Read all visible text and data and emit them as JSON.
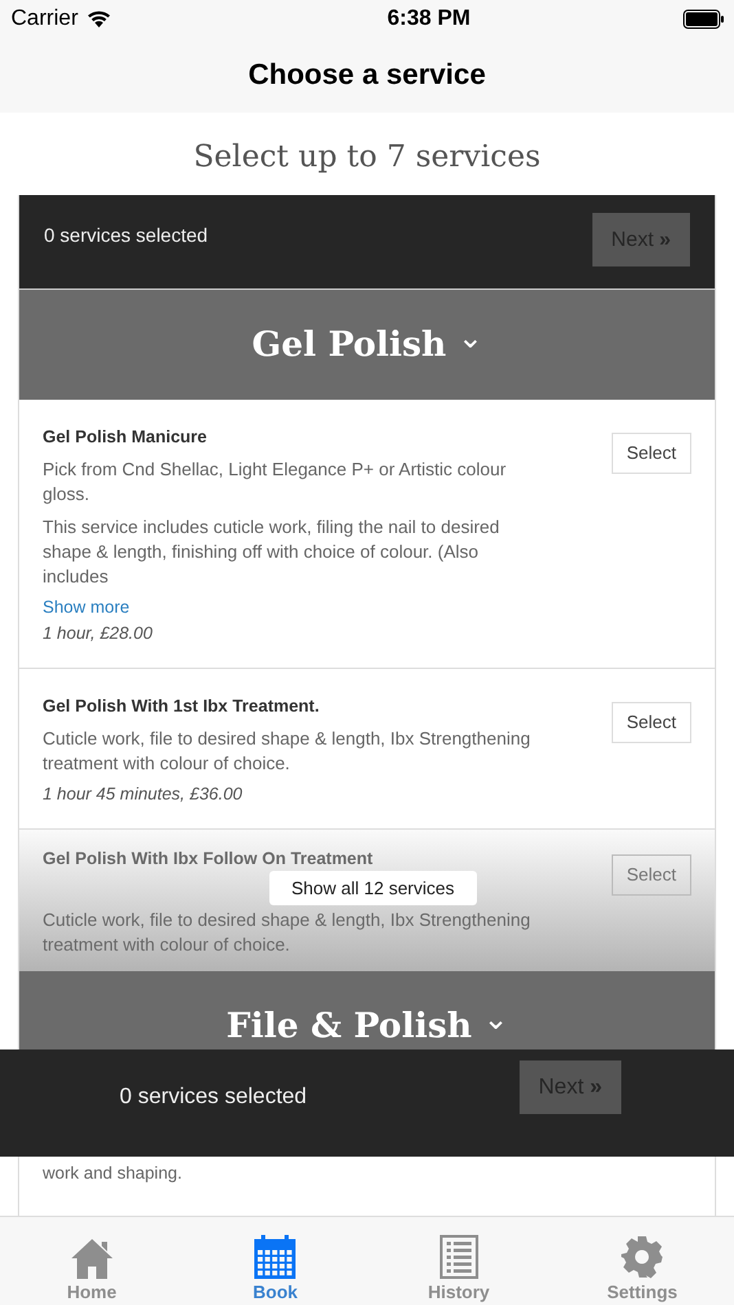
{
  "status_bar": {
    "carrier": "Carrier",
    "time": "6:38 PM"
  },
  "nav_bar": {
    "title": "Choose a service"
  },
  "heading": "Select up to 7 services",
  "selection_bar": {
    "count": "0 services selected",
    "next": "Next",
    "next_icon": "»"
  },
  "sections": [
    {
      "title": "Gel Polish",
      "chevron": "⌄",
      "services": [
        {
          "name": "Gel Polish Manicure",
          "paragraphs": [
            "Pick from Cnd Shellac, Light Elegance P+ or Artistic colour gloss.",
            "This service includes cuticle work, filing the nail to desired shape & length, finishing off with choice of colour. (Also includes"
          ],
          "show_more": "Show more",
          "duration": "1 hour, £28.00",
          "button": "Select",
          "faded": false
        },
        {
          "name": "Gel Polish With 1st Ibx Treatment.",
          "paragraphs": [
            "Cuticle work, file to desired shape & length, Ibx Strengthening treatment with colour of choice."
          ],
          "duration": "1 hour 45 minutes, £36.00",
          "button": "Select",
          "faded": false
        },
        {
          "name": "Gel Polish With Ibx Follow On Treatment",
          "paragraphs": [
            "Cuticle work, file to desired shape & length, Ibx Strengthening treatment with colour of choice."
          ],
          "button": "Select",
          "faded": true
        }
      ],
      "show_all": "Show all 12 services"
    },
    {
      "title": "File & Polish",
      "chevron": "⌄"
    }
  ],
  "sticky_bar": {
    "count": "0 services selected",
    "next": "Next",
    "next_icon": "»"
  },
  "partial_text": "work and shaping.",
  "tabs": [
    {
      "label": "Home",
      "selected": false
    },
    {
      "label": "Book",
      "selected": true
    },
    {
      "label": "History",
      "selected": false
    },
    {
      "label": "Settings",
      "selected": false
    }
  ]
}
